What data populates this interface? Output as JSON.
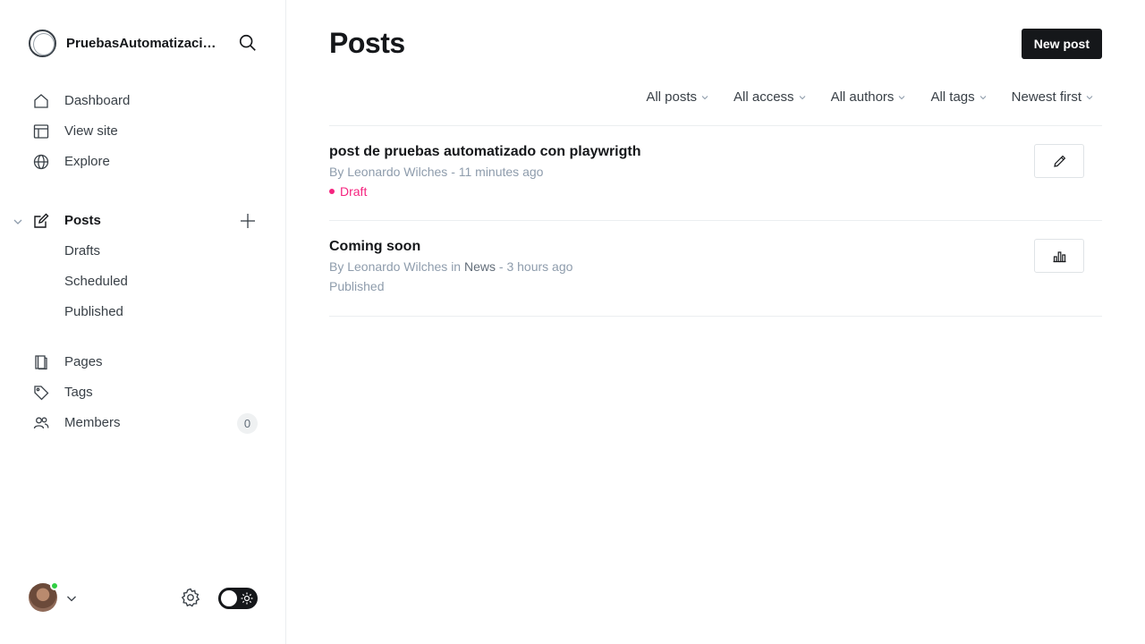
{
  "site": {
    "title": "PruebasAutomatizaci…"
  },
  "nav": {
    "dashboard": "Dashboard",
    "view_site": "View site",
    "explore": "Explore",
    "posts": "Posts",
    "drafts": "Drafts",
    "scheduled": "Scheduled",
    "published": "Published",
    "pages": "Pages",
    "tags": "Tags",
    "members": "Members",
    "members_count": "0"
  },
  "main": {
    "title": "Posts",
    "new_post_label": "New post",
    "filters": {
      "type": "All posts",
      "access": "All access",
      "authors": "All authors",
      "tags": "All tags",
      "order": "Newest first"
    },
    "posts": [
      {
        "title": "post de pruebas automatizado con playwrigth",
        "meta_prefix": "By",
        "author": "Leonardo Wilches",
        "meta_time": "- 11 minutes ago",
        "status": "Draft"
      },
      {
        "title": "Coming soon",
        "meta_prefix": "By",
        "author": "Leonardo Wilches",
        "meta_in": "in",
        "tag": "News",
        "meta_time": "- 3 hours ago",
        "status": "Published"
      }
    ]
  },
  "colors": {
    "accent": "#15171a",
    "draft": "#f5247f",
    "online": "#30cf43",
    "muted": "#8e9cac"
  },
  "icons": {
    "search": "search-icon",
    "dashboard": "home-icon",
    "view_site": "layout-icon",
    "explore": "globe-icon",
    "posts": "edit-icon",
    "pages": "page-icon",
    "tags": "tag-icon",
    "members": "users-icon",
    "settings": "gear-icon",
    "edit_action": "pencil-icon",
    "analytics_action": "bar-chart-icon"
  }
}
